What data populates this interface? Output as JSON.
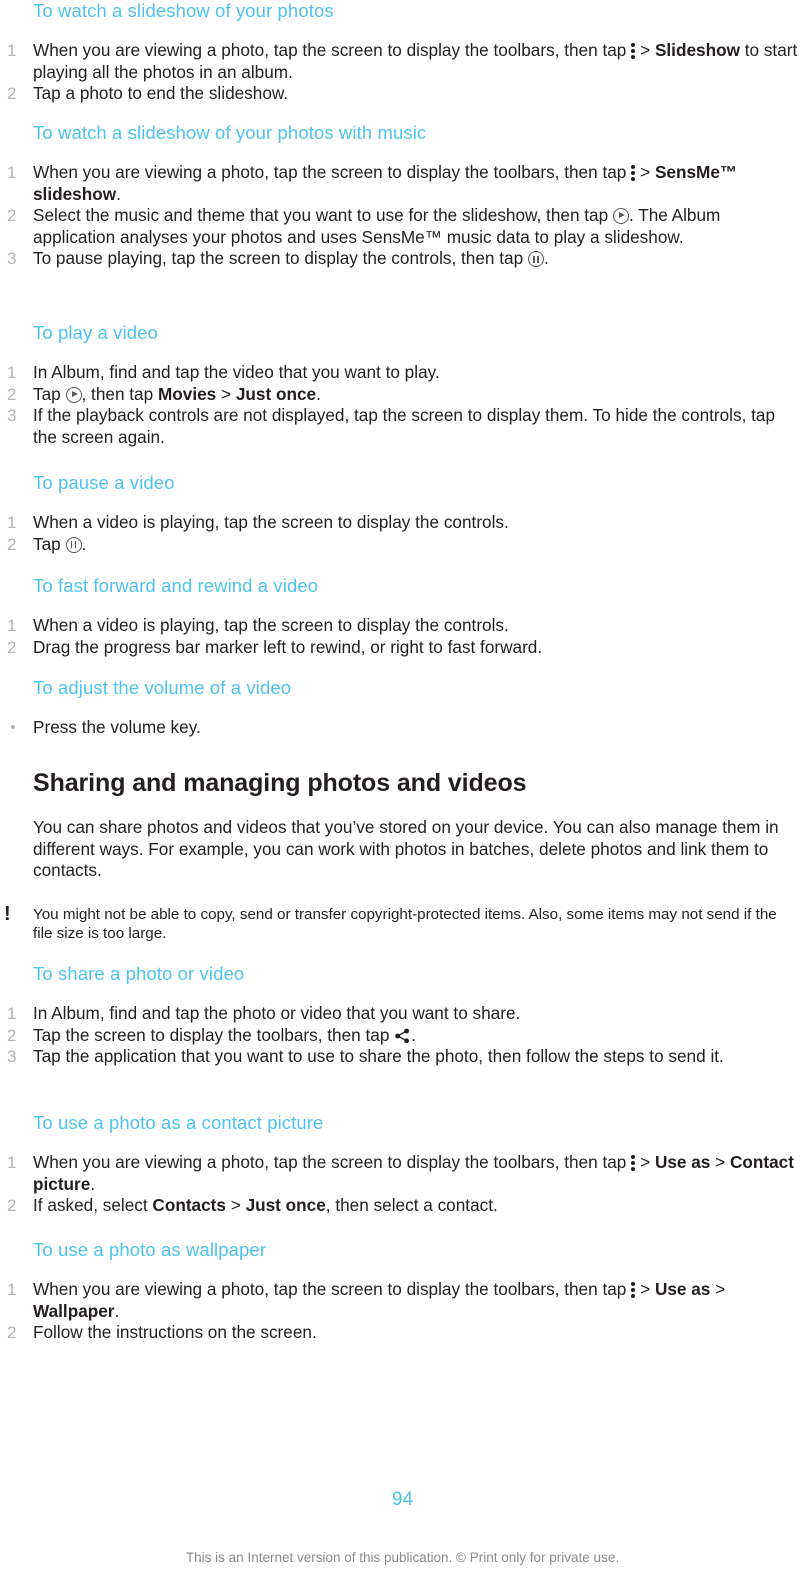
{
  "document": {
    "page_number": "94",
    "footer_note": "This is an Internet version of this publication. © Print only for private use.",
    "accent_color": "#4ec3ef",
    "text_color": "#231f20",
    "step_number_color": "#b3b3b3"
  },
  "sections": [
    {
      "id": "slideshow",
      "heading": "To watch a slideshow of your photos",
      "steps": [
        {
          "num": "1",
          "parts": [
            {
              "type": "text",
              "text": "When you are viewing a photo, tap the screen to display the toolbars, then tap "
            },
            {
              "type": "icon",
              "icon": "overflow-menu-icon"
            },
            {
              "type": "text",
              "text": "> "
            },
            {
              "type": "bold",
              "text": "Slideshow"
            },
            {
              "type": "text",
              "text": " to start playing all the photos in an album."
            }
          ],
          "plain": "When you are viewing a photo, tap the screen to display the toolbars, then tap ⋮ > Slideshow to start playing all the photos in an album."
        },
        {
          "num": "2",
          "parts": [
            {
              "type": "text",
              "text": "Tap a photo to end the slideshow."
            }
          ],
          "plain": "Tap a photo to end the slideshow."
        }
      ]
    },
    {
      "id": "slideshow-music",
      "heading": "To watch a slideshow of your photos with music",
      "steps": [
        {
          "num": "1",
          "plain": "When you are viewing a photo, tap the screen to display the toolbars, then tap ⋮ > SensMe™ slideshow."
        },
        {
          "num": "2",
          "plain": "Select the music and theme that you want to use for the slideshow, then tap ▶. The Album application analyses your photos and uses SensMe™ music data to play a slideshow."
        },
        {
          "num": "3",
          "plain": "To pause playing, tap the screen to display the controls, then tap ⏸."
        }
      ]
    },
    {
      "id": "play-video",
      "heading": "To play a video",
      "steps": [
        {
          "num": "1",
          "plain": "In Album, find and tap the video that you want to play."
        },
        {
          "num": "2",
          "plain": "Tap ▶, then tap Movies > Just once."
        },
        {
          "num": "3",
          "plain": "If the playback controls are not displayed, tap the screen to display them. To hide the controls, tap the screen again."
        }
      ]
    },
    {
      "id": "pause-video",
      "heading": "To pause a video",
      "steps": [
        {
          "num": "1",
          "plain": "When a video is playing, tap the screen to display the controls."
        },
        {
          "num": "2",
          "plain": "Tap ⏸."
        }
      ]
    },
    {
      "id": "ff-rewind",
      "heading": "To fast forward and rewind a video",
      "steps": [
        {
          "num": "1",
          "plain": "When a video is playing, tap the screen to display the controls."
        },
        {
          "num": "2",
          "plain": "Drag the progress bar marker left to rewind, or right to fast forward."
        }
      ]
    },
    {
      "id": "adjust-volume",
      "heading": "To adjust the volume of a video",
      "steps": [
        {
          "num": "•",
          "plain": "Press the volume key."
        }
      ]
    },
    {
      "id": "sharing-managing",
      "title": "Sharing and managing photos and videos",
      "body": "You can share photos and videos that you’ve stored on your device. You can also manage them in different ways. For example, you can work with photos in batches, delete photos and link them to contacts.",
      "note": "You might not be able to copy, send or transfer copyright-protected items. Also, some items may not send if the file size is too large."
    },
    {
      "id": "share-photo",
      "heading": "To share a photo or video",
      "steps": [
        {
          "num": "1",
          "plain": "In Album, find and tap the photo or video that you want to share."
        },
        {
          "num": "2",
          "plain": "Tap the screen to display the toolbars, then tap ⤴."
        },
        {
          "num": "3",
          "plain": "Tap the application that you want to use to share the photo, then follow the steps to send it."
        }
      ]
    },
    {
      "id": "contact-picture",
      "heading": "To use a photo as a contact picture",
      "steps": [
        {
          "num": "1",
          "plain": "When you are viewing a photo, tap the screen to display the toolbars, then tap ⋮ > Use as > Contact picture."
        },
        {
          "num": "2",
          "plain": "If asked, select Contacts > Just once, then select a contact."
        }
      ]
    },
    {
      "id": "wallpaper",
      "heading": "To use a photo as wallpaper",
      "steps": [
        {
          "num": "1",
          "plain": "When you are viewing a photo, tap the screen to display the toolbars, then tap ⋮ > Use as > Wallpaper."
        },
        {
          "num": "2",
          "plain": "Follow the instructions on the screen."
        }
      ]
    }
  ],
  "text": {
    "h_slideshow": "To watch a slideshow of your photos",
    "s1_1a": "When you are viewing a photo, tap the screen to display the toolbars, then tap",
    "s1_1_gt": "> ",
    "s1_1_bold": "Slideshow",
    "s1_1b": " to start playing all the photos in an album.",
    "s1_2": "Tap a photo to end the slideshow.",
    "h_slideshow_music": "To watch a slideshow of your photos with music",
    "s2_1a": "When you are viewing a photo, tap the screen to display the toolbars, then tap",
    "s2_1_gt": "> ",
    "s2_1_bold": "SensMe™ slideshow",
    "s2_1b": ".",
    "s2_2a": "Select the music and theme that you want to use for the slideshow, then tap",
    "s2_2b": ". The Album application analyses your photos and uses SensMe™ music data to play a slideshow.",
    "s2_3a": "To pause playing, tap the screen to display the controls, then tap ",
    "s2_3b": ".",
    "h_play_video": "To play a video",
    "s3_1": "In Album, find and tap the video that you want to play.",
    "s3_2a": "Tap ",
    "s3_2b": ", then tap ",
    "s3_2_bold1": "Movies",
    "s3_2_gt": " > ",
    "s3_2_bold2": "Just once",
    "s3_2c": ".",
    "s3_3": "If the playback controls are not displayed, tap the screen to display them. To hide the controls, tap the screen again.",
    "h_pause_video": "To pause a video",
    "s4_1": "When a video is playing, tap the screen to display the controls.",
    "s4_2a": "Tap ",
    "s4_2b": ".",
    "h_ff_rewind": "To fast forward and rewind a video",
    "s5_1": "When a video is playing, tap the screen to display the controls.",
    "s5_2": "Drag the progress bar marker left to rewind, or right to fast forward.",
    "h_volume": "To adjust the volume of a video",
    "s6_1": "Press the volume key.",
    "h_sharing": "Sharing and managing photos and videos",
    "p_sharing": "You can share photos and videos that you’ve stored on your device. You can also manage them in different ways. For example, you can work with photos in batches, delete photos and link them to contacts.",
    "note_sharing": "You might not be able to copy, send or transfer copyright-protected items. Also, some items may not send if the file size is too large.",
    "warn_glyph": "!",
    "h_share_photo": "To share a photo or video",
    "s7_1": "In Album, find and tap the photo or video that you want to share.",
    "s7_2a": "Tap the screen to display the toolbars, then tap ",
    "s7_2b": ".",
    "s7_3": "Tap the application that you want to use to share the photo, then follow the steps to send it.",
    "h_contact_picture": "To use a photo as a contact picture",
    "s8_1a": "When you are viewing a photo, tap the screen to display the toolbars, then tap",
    "s8_1_gt": "> ",
    "s8_1_bold1": "Use as",
    "s8_1_gt2": " > ",
    "s8_1_bold2": "Contact picture",
    "s8_1b": ".",
    "s8_2a": "If asked, select ",
    "s8_2_bold1": "Contacts",
    "s8_2_gt": " > ",
    "s8_2_bold2": "Just once",
    "s8_2b": ", then select a contact.",
    "h_wallpaper": "To use a photo as wallpaper",
    "s9_1a": "When you are viewing a photo, tap the screen to display the toolbars, then tap",
    "s9_1_gt": "> ",
    "s9_1_bold1": "Use as",
    "s9_1_gt2": " > ",
    "s9_1_bold2": "Wallpaper",
    "s9_1b": ".",
    "s9_2": "Follow the instructions on the screen.",
    "page_number": "94",
    "footer": "This is an Internet version of this publication. © Print only for private use."
  }
}
